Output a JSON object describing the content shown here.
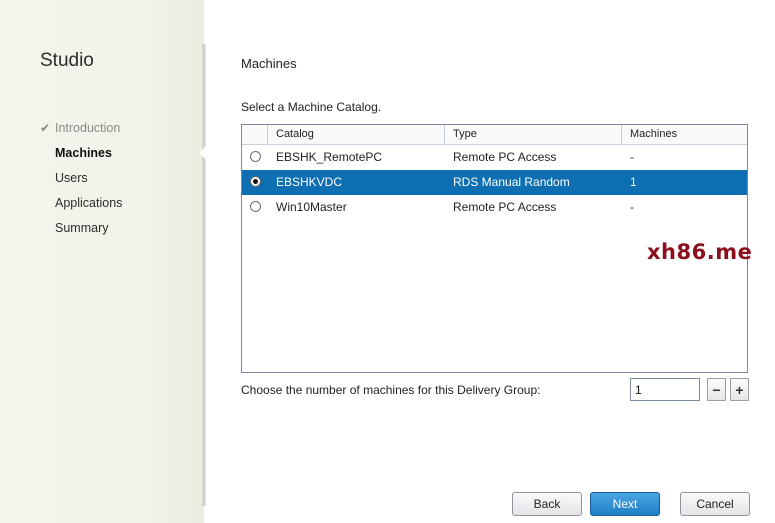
{
  "sidebar": {
    "brand": "Studio",
    "steps": [
      {
        "label": "Introduction",
        "state": "done"
      },
      {
        "label": "Machines",
        "state": "active"
      },
      {
        "label": "Users",
        "state": "pending"
      },
      {
        "label": "Applications",
        "state": "pending"
      },
      {
        "label": "Summary",
        "state": "pending"
      }
    ]
  },
  "main": {
    "title": "Machines",
    "instruction": "Select a Machine Catalog.",
    "grid": {
      "columns": [
        "Catalog",
        "Type",
        "Machines"
      ],
      "rows": [
        {
          "catalog": "EBSHK_RemotePC",
          "type": "Remote PC Access",
          "machines": "-",
          "selected": false
        },
        {
          "catalog": "EBSHKVDC",
          "type": "RDS Manual Random",
          "machines": "1",
          "selected": true
        },
        {
          "catalog": "Win10Master",
          "type": "Remote PC Access",
          "machines": "-",
          "selected": false
        }
      ]
    },
    "count_label": "Choose the number of machines for this Delivery Group:",
    "count_value": "1",
    "minus_label": "−",
    "plus_label": "+",
    "watermark": "xh86.me"
  },
  "footer": {
    "back_label": "Back",
    "next_label": "Next",
    "cancel_label": "Cancel"
  },
  "colors": {
    "selection": "#0d6fb1",
    "watermark": "#8b0f1c",
    "primary_button": "#1e7fc6"
  }
}
